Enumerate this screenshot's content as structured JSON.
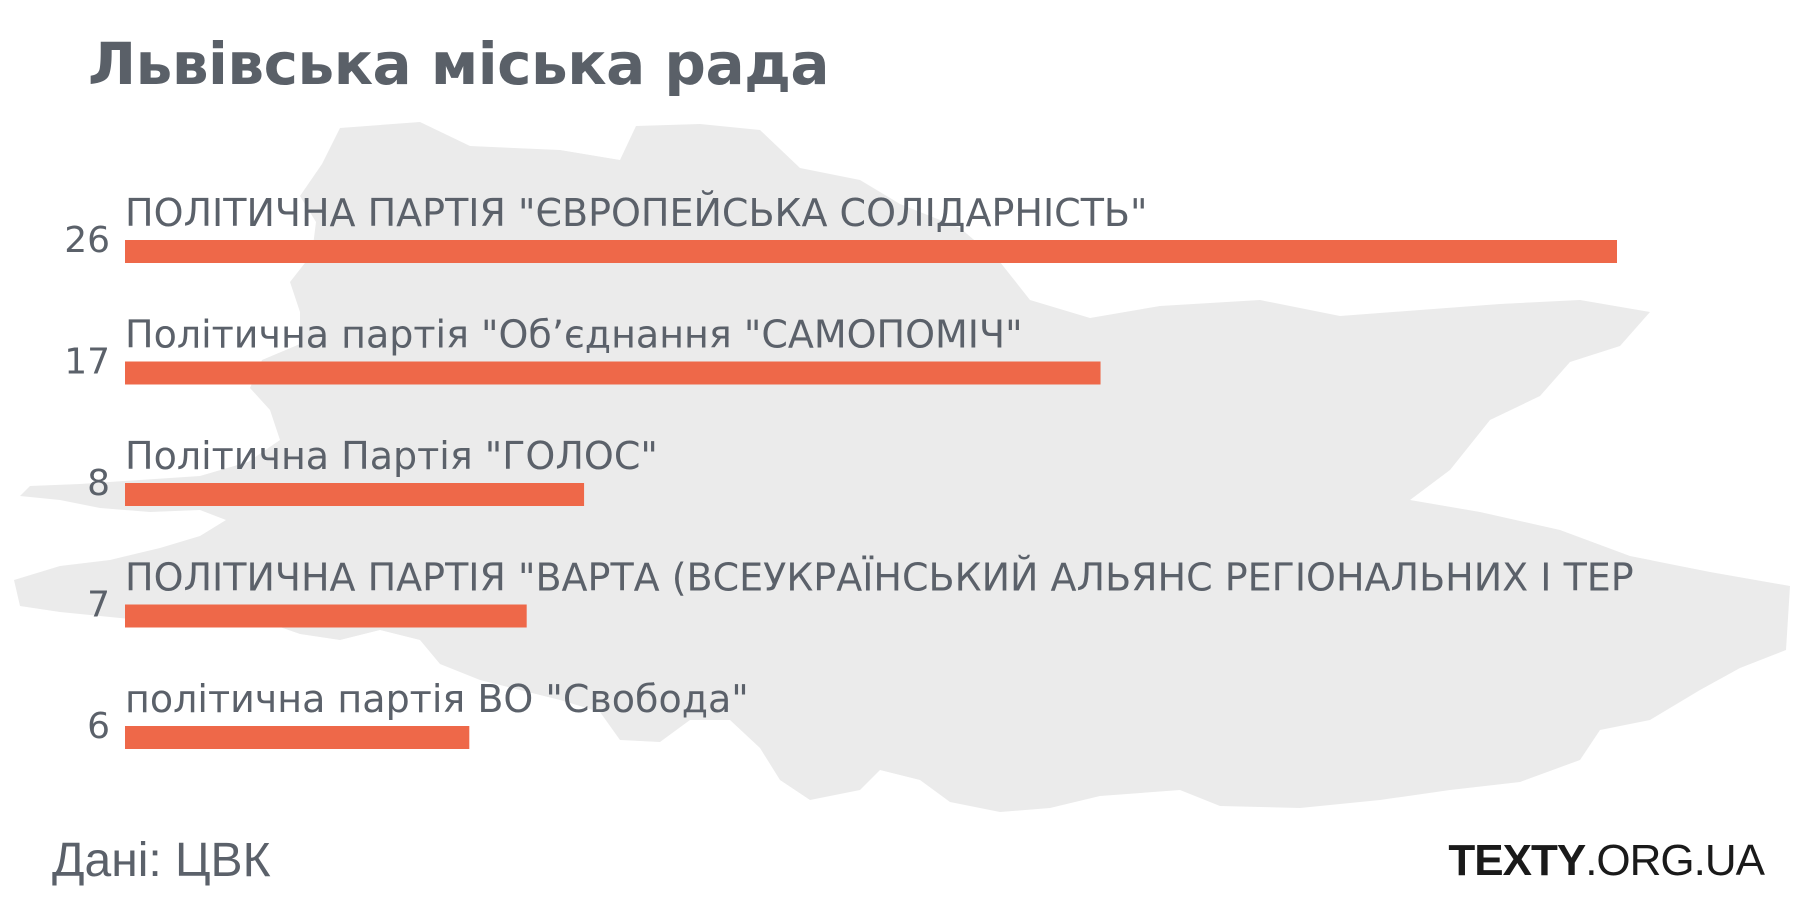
{
  "title": "Львівська міська рада",
  "colors": {
    "bar": "#EE6849",
    "text": "#5B616A",
    "title": "#5A6068",
    "map": "#EBEBEB"
  },
  "icons": {
    "background": "lviv-city-map-silhouette"
  },
  "footer": {
    "source": "Дані: ЦВК",
    "logo_main": "TEXTY",
    "logo_suffix": ".ORG.UA"
  },
  "chart_data": {
    "type": "bar",
    "orientation": "horizontal",
    "title": "Львівська міська рада",
    "categories": [
      "ПОЛІТИЧНА ПАРТІЯ \"ЄВРОПЕЙСЬКА СОЛІДАРНІСТЬ\"",
      "Політична партія \"Об’єднання \"САМОПОМІЧ\"",
      "Політична Партія \"ГОЛОС\"",
      "ПОЛІТИЧНА ПАРТІЯ \"ВАРТА (ВСЕУКРАЇНСЬКИЙ АЛЬЯНС РЕГІОНАЛЬНИХ І ТЕР",
      "політична партія ВО \"Свобода\""
    ],
    "values": [
      26,
      17,
      8,
      7,
      6
    ],
    "xlim": [
      0,
      26
    ],
    "grid": false,
    "legend": "none",
    "data_labels": "left-of-bar"
  }
}
